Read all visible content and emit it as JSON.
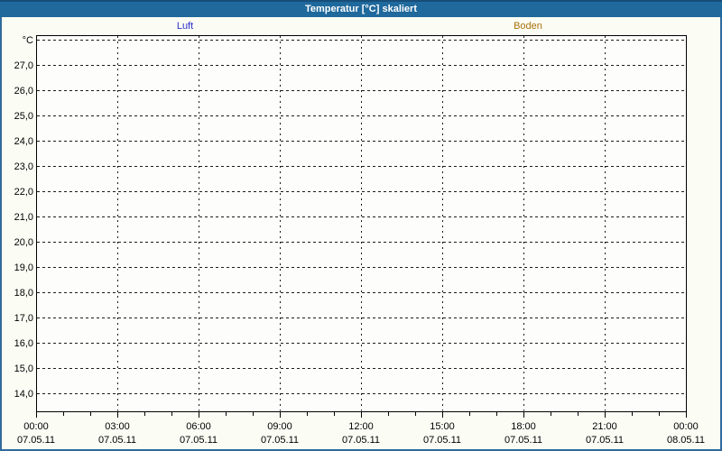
{
  "window": {
    "title": "Temperatur [°C] skaliert"
  },
  "colors": {
    "titlebar_bg": "#1f699c",
    "titlebar_border_top": "#174e78",
    "titlebar_text": "#ffffff",
    "window_border": "#2f6a9c",
    "background": "#fbfdf5",
    "plot_background": "#fdfefb",
    "grid": "#1c1c1c",
    "axis": "#000000",
    "series_luft": "#2e2ec9",
    "series_boden": "#a8700a"
  },
  "chart_data": {
    "type": "line",
    "title": "Temperatur [°C] skaliert",
    "legend_position": "top",
    "grid": true,
    "note": "empty plot: grid and axes only, no data points drawn",
    "series": [
      {
        "name": "Luft",
        "color": "#2e2ec9",
        "values": []
      },
      {
        "name": "Boden",
        "color": "#a8700a",
        "values": []
      }
    ],
    "y_axis": {
      "unit": "°C",
      "tick_values": [
        27,
        26,
        25,
        24,
        23,
        22,
        21,
        20,
        19,
        18,
        17,
        16,
        15,
        14
      ],
      "tick_labels": [
        "27,0",
        "26,0",
        "25,0",
        "24,0",
        "23,0",
        "22,0",
        "21,0",
        "20,0",
        "19,0",
        "18,0",
        "17,0",
        "16,0",
        "15,0",
        "14,0"
      ],
      "unlabeled_top_gridline_value": 28,
      "ylim_shown": [
        14,
        28
      ]
    },
    "x_axis": {
      "minor_tick_every_hours": 1,
      "major_tick_every_hours": 3,
      "span_hours": 24,
      "major_ticks": [
        {
          "hour": 0,
          "time": "00:00",
          "date": "07.05.11"
        },
        {
          "hour": 3,
          "time": "03:00",
          "date": "07.05.11"
        },
        {
          "hour": 6,
          "time": "06:00",
          "date": "07.05.11"
        },
        {
          "hour": 9,
          "time": "09:00",
          "date": "07.05.11"
        },
        {
          "hour": 12,
          "time": "12:00",
          "date": "07.05.11"
        },
        {
          "hour": 15,
          "time": "15:00",
          "date": "07.05.11"
        },
        {
          "hour": 18,
          "time": "18:00",
          "date": "07.05.11"
        },
        {
          "hour": 21,
          "time": "21:00",
          "date": "07.05.11"
        },
        {
          "hour": 24,
          "time": "00:00",
          "date": "08.05.11"
        }
      ]
    }
  }
}
